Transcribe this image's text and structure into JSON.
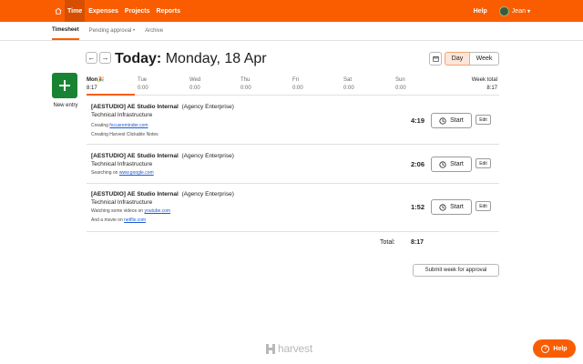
{
  "nav": {
    "items": [
      "Time",
      "Expenses",
      "Projects",
      "Reports"
    ],
    "help": "Help",
    "user": "Jean"
  },
  "subnav": {
    "items": [
      "Timesheet",
      "Pending approval",
      "Archive"
    ],
    "pending_caret": "•"
  },
  "header": {
    "today_label": "Today:",
    "date": "Monday, 18 Apr",
    "prev": "←",
    "next": "→",
    "day_label": "Day",
    "week_label": "Week"
  },
  "new_entry_label": "New entry",
  "week": {
    "days": [
      {
        "name": "Mon",
        "value": "8:17",
        "emoji": "🎉"
      },
      {
        "name": "Tue",
        "value": "0:00"
      },
      {
        "name": "Wed",
        "value": "0:00"
      },
      {
        "name": "Thu",
        "value": "0:00"
      },
      {
        "name": "Fri",
        "value": "0:00"
      },
      {
        "name": "Sat",
        "value": "0:00"
      },
      {
        "name": "Sun",
        "value": "0:00"
      }
    ],
    "total_label": "Week total",
    "total_value": "8:17"
  },
  "entries": [
    {
      "project": "[AESTUDIO] AE Studio Internal",
      "client": "(Agency Enterprise)",
      "task": "Technical Infrastructure",
      "note1_text": "Creating ",
      "note1_link": "focusreminder.com",
      "note2_text": "Creating Harvest Clickable Notes",
      "duration": "4:19",
      "start": "Start",
      "edit": "Edit"
    },
    {
      "project": "[AESTUDIO] AE Studio Internal",
      "client": "(Agency Enterprise)",
      "task": "Technical Infrastructure",
      "note1_text": "Searching on ",
      "note1_link": "www.google.com",
      "duration": "2:06",
      "start": "Start",
      "edit": "Edit"
    },
    {
      "project": "[AESTUDIO] AE Studio Internal",
      "client": "(Agency Enterprise)",
      "task": "Technical Infrastructure",
      "note1_text": "Watching some videos on ",
      "note1_link": "youtube.com",
      "note2_text": "And a movie on ",
      "note2_link": "netflix.com",
      "duration": "1:52",
      "start": "Start",
      "edit": "Edit"
    }
  ],
  "totals": {
    "label": "Total:",
    "value": "8:17"
  },
  "submit_label": "Submit week for approval",
  "footer_logo": "harvest",
  "help_fab": "Help",
  "colors": {
    "brand": "#fa5d00",
    "new_entry": "#188433",
    "link": "#1b5ad6"
  }
}
